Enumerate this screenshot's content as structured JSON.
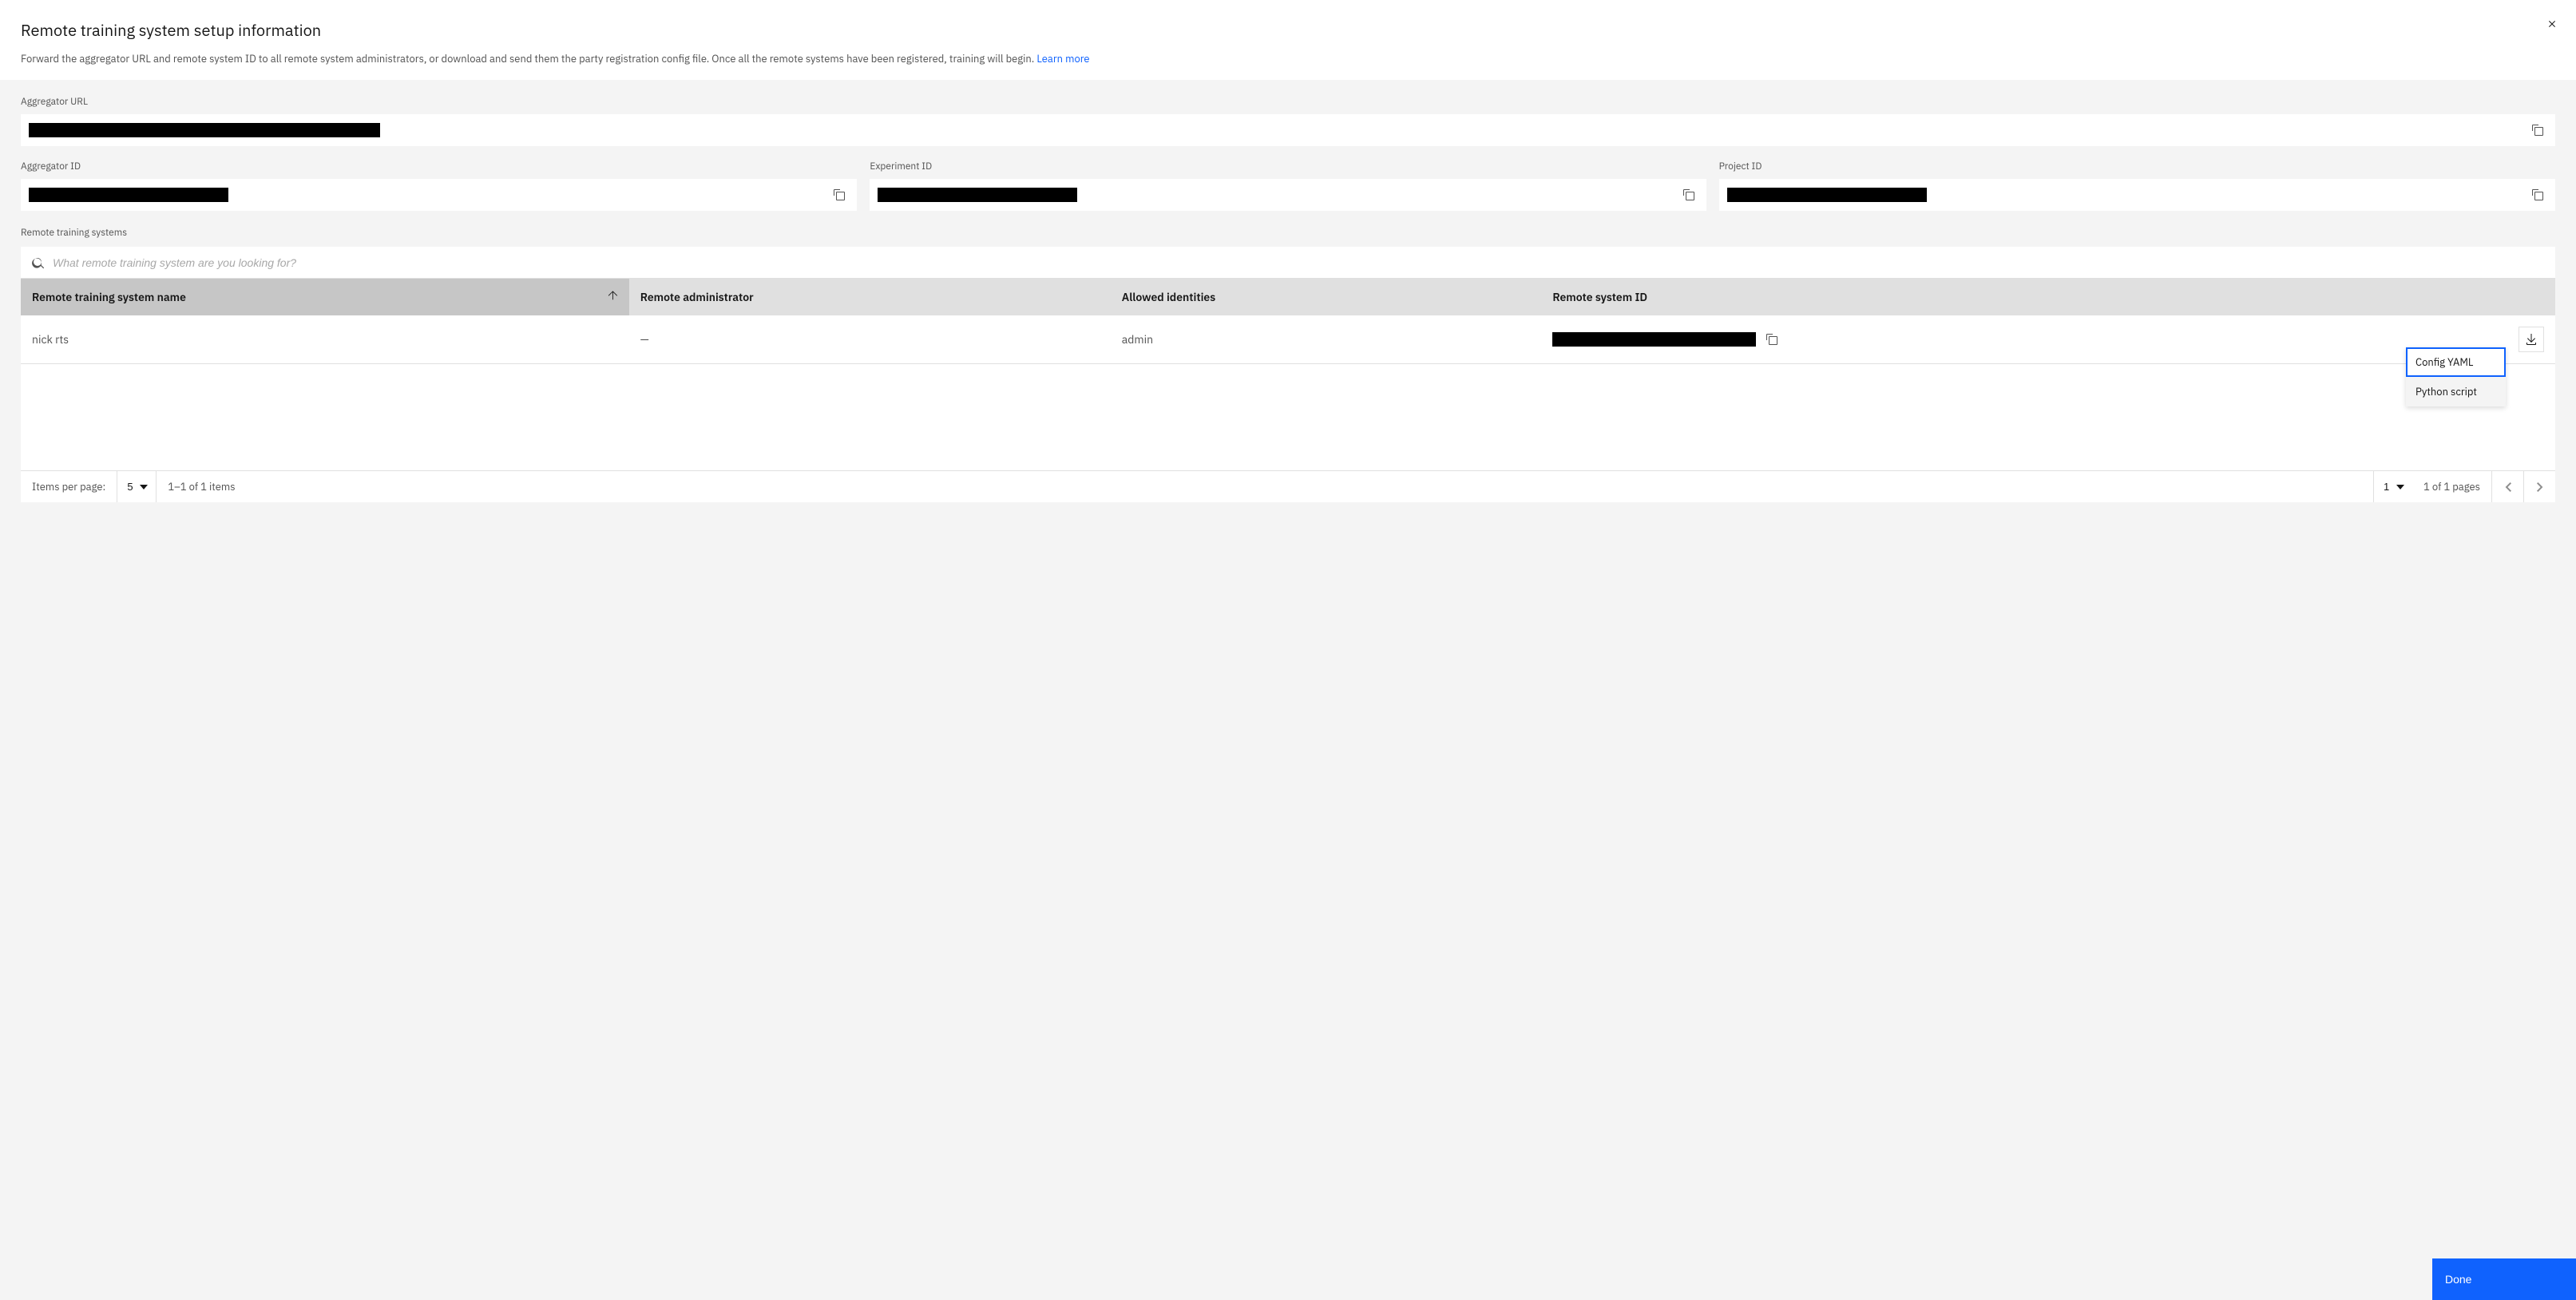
{
  "header": {
    "title": "Remote training system setup information",
    "subtitle": "Forward the aggregator URL and remote system ID to all remote system administrators, or download and send them the party registration config file. Once all the remote systems have been registered, training will begin. ",
    "learn_more": "Learn more"
  },
  "fields": {
    "aggregator_url_label": "Aggregator URL",
    "aggregator_id_label": "Aggregator ID",
    "experiment_id_label": "Experiment ID",
    "project_id_label": "Project ID"
  },
  "rts": {
    "section_label": "Remote training systems",
    "search_placeholder": "What remote training system are you looking for?",
    "columns": {
      "name": "Remote training system name",
      "admin": "Remote administrator",
      "identities": "Allowed identities",
      "sysid": "Remote system ID"
    },
    "rows": [
      {
        "name": "nick rts",
        "admin": "—",
        "identities": "admin"
      }
    ],
    "dropdown": {
      "config_yaml": "Config YAML",
      "python_script": "Python script"
    }
  },
  "pagination": {
    "items_per_page_label": "Items per page:",
    "items_per_page_value": "5",
    "range_text": "1–1 of 1 items",
    "page_value": "1",
    "pages_text": "1 of 1 pages"
  },
  "footer": {
    "done": "Done"
  }
}
